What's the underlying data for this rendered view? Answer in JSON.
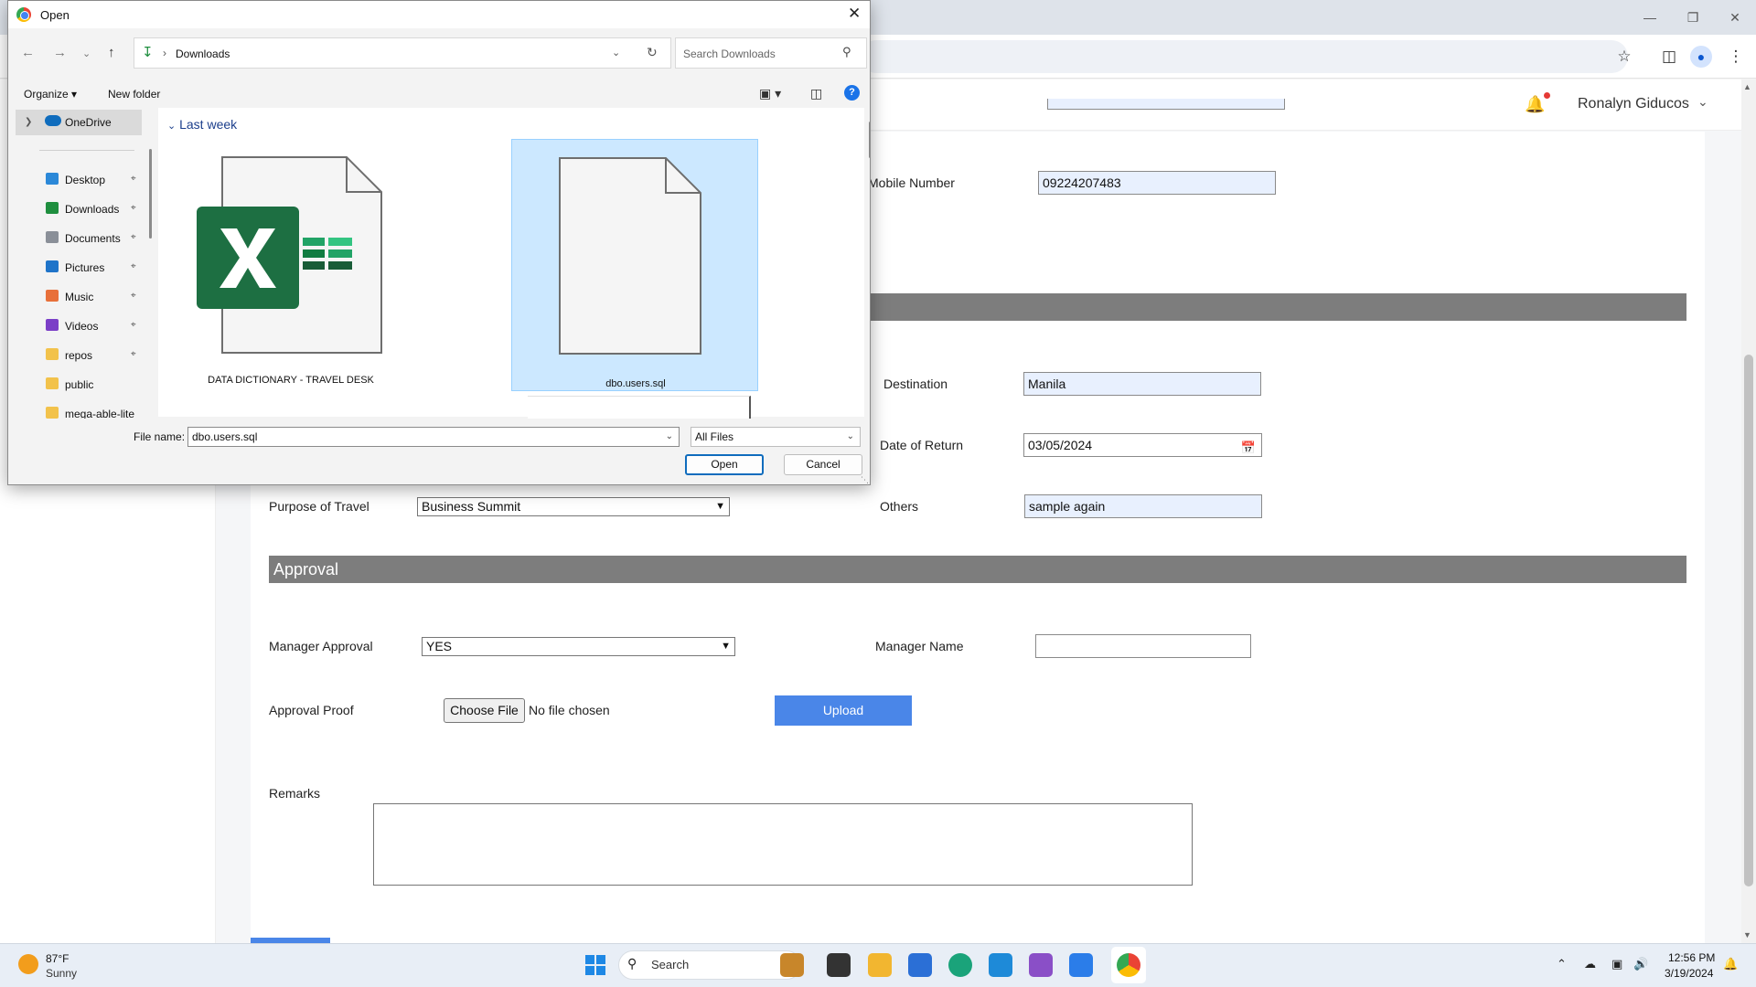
{
  "browser": {
    "profile_icon": "person-icon"
  },
  "app": {
    "user_name": "Ronalyn Giducos"
  },
  "form": {
    "mobile_label": "Mobile Number",
    "mobile_value": "09224207483",
    "destination_label": "Destination",
    "destination_value": "Manila",
    "return_label": "Date of Return",
    "return_value": "03/05/2024",
    "purpose_label": "Purpose of Travel",
    "purpose_value": "Business Summit",
    "others_label": "Others",
    "others_value": "sample again"
  },
  "approval": {
    "section_title": "Approval",
    "manager_approval_label": "Manager Approval",
    "manager_approval_value": "YES",
    "manager_name_label": "Manager Name",
    "manager_name_value": "",
    "proof_label": "Approval Proof",
    "choose_file_label": "Choose File",
    "no_file_text": "No file chosen",
    "upload_label": "Upload",
    "remarks_label": "Remarks"
  },
  "dialog": {
    "title": "Open",
    "address_location": "Downloads",
    "search_placeholder": "Search Downloads",
    "organize_label": "Organize",
    "new_folder_label": "New folder",
    "help_label": "?",
    "nav_root": "OneDrive",
    "nav_items": [
      {
        "label": "Desktop",
        "icon": "desktop-icon",
        "color": "#2b88d8"
      },
      {
        "label": "Downloads",
        "icon": "download-icon",
        "color": "#1e8e3e"
      },
      {
        "label": "Documents",
        "icon": "documents-icon",
        "color": "#8a8f98"
      },
      {
        "label": "Pictures",
        "icon": "pictures-icon",
        "color": "#1f74c9"
      },
      {
        "label": "Music",
        "icon": "music-icon",
        "color": "#e8703a"
      },
      {
        "label": "Videos",
        "icon": "videos-icon",
        "color": "#7b3fc7"
      },
      {
        "label": "repos",
        "icon": "folder-icon",
        "color": "#f2c24b"
      },
      {
        "label": "public",
        "icon": "folder-icon",
        "color": "#f2c24b"
      },
      {
        "label": "mega-able-lite",
        "icon": "folder-icon",
        "color": "#f2c24b"
      }
    ],
    "group_label": "Last week",
    "files": [
      {
        "name": "DATA DICTIONARY - TRAVEL DESK",
        "icon": "excel-file-icon"
      },
      {
        "name": "dbo.users.sql",
        "icon": "blank-file-icon"
      }
    ],
    "file_name_label": "File name:",
    "file_name_value": "dbo.users.sql",
    "file_type_value": "All Files",
    "open_label": "Open",
    "cancel_label": "Cancel"
  },
  "taskbar": {
    "weather_temp": "87°F",
    "weather_condition": "Sunny",
    "search_label": "Search",
    "time": "12:56 PM",
    "date": "3/19/2024"
  },
  "colors": {
    "accent": "#4a86e8",
    "section_bar": "#7d7d7d",
    "selection": "#cce8ff",
    "excel_green": "#1d6f42"
  }
}
